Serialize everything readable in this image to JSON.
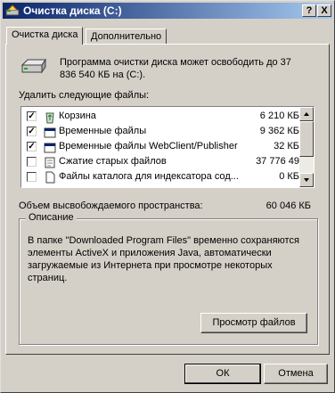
{
  "window": {
    "title": "Очистка диска  (C:)",
    "help_button": "?",
    "close_button": "X",
    "accent_color": "#0a246a"
  },
  "tabs": [
    {
      "label": "Очистка диска",
      "active": true
    },
    {
      "label": "Дополнительно",
      "active": false
    }
  ],
  "intro": {
    "icon": "disk-drive-icon",
    "text": "Программа очистки диска может освободить до 37 836 540 КБ на  (C:)."
  },
  "files_section": {
    "label": "Удалить следующие файлы:",
    "items": [
      {
        "checked": true,
        "icon": "recycle-bin-icon",
        "name": "Корзина",
        "size": "6 210 КБ"
      },
      {
        "checked": true,
        "icon": "temp-files-icon",
        "name": "Временные файлы",
        "size": "9 362 КБ"
      },
      {
        "checked": true,
        "icon": "temp-files-icon",
        "name": "Временные файлы WebClient/Publisher",
        "size": "32 КБ"
      },
      {
        "checked": false,
        "icon": "compress-icon",
        "name": "Сжатие старых файлов",
        "size": "37 776 49"
      },
      {
        "checked": false,
        "icon": "document-icon",
        "name": "Файлы каталога для индексатора сод...",
        "size": "0 КБ"
      }
    ]
  },
  "freed_space": {
    "label": "Объем высвобождаемого пространства:",
    "value": "60 046 КБ"
  },
  "description": {
    "title": "Описание",
    "text": "В папке \"Downloaded Program Files\" временно сохраняются элементы ActiveX и приложения Java, автоматически загружаемые из Интернета при просмотре некоторых страниц.",
    "view_files_button": "Просмотр файлов"
  },
  "footer": {
    "ok_button": "ОК",
    "cancel_button": "Отмена"
  }
}
